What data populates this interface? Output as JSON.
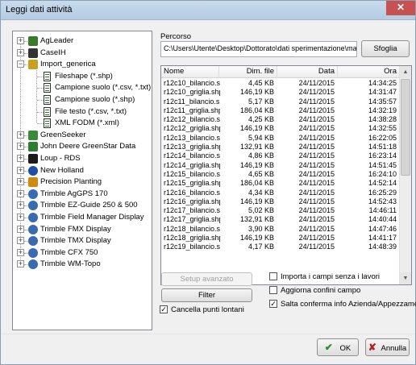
{
  "window": {
    "title": "Leggi dati attività",
    "close_glyph": "✕"
  },
  "tree": {
    "items": [
      {
        "label": "AgLeader",
        "icon": "agleader-logo-icon",
        "expander": "+"
      },
      {
        "label": "CaseIH",
        "icon": "caseih-logo-icon",
        "expander": "+"
      },
      {
        "label": "Import_generica",
        "icon": "folder-icon",
        "expander": "−"
      },
      {
        "label": "Fileshape (*.shp)",
        "icon": "document-icon"
      },
      {
        "label": "Campione suolo (*.csv, *.txt)",
        "icon": "document-icon"
      },
      {
        "label": "Campione suolo (*.shp)",
        "icon": "document-icon"
      },
      {
        "label": "File testo (*.csv, *.txt)",
        "icon": "document-icon"
      },
      {
        "label": "XML FODM (*.xml)",
        "icon": "document-icon"
      },
      {
        "label": "GreenSeeker",
        "icon": "greenseeker-logo-icon",
        "expander": "+"
      },
      {
        "label": "John Deere GreenStar Data",
        "icon": "john-deere-logo-icon",
        "expander": "+"
      },
      {
        "label": "Loup - RDS",
        "icon": "loup-logo-icon",
        "expander": "+"
      },
      {
        "label": "New Holland",
        "icon": "new-holland-logo-icon",
        "expander": "+"
      },
      {
        "label": "Precision Planting",
        "icon": "precision-planting-logo-icon",
        "expander": "+"
      },
      {
        "label": "Trimble AgGPS 170",
        "icon": "trimble-logo-icon",
        "expander": "+"
      },
      {
        "label": "Trimble EZ-Guide 250 & 500",
        "icon": "trimble-logo-icon",
        "expander": "+"
      },
      {
        "label": "Trimble Field Manager Display",
        "icon": "trimble-logo-icon",
        "expander": "+"
      },
      {
        "label": "Trimble FMX Display",
        "icon": "trimble-logo-icon",
        "expander": "+"
      },
      {
        "label": "Trimble TMX Display",
        "icon": "trimble-logo-icon",
        "expander": "+"
      },
      {
        "label": "Trimble CFX 750",
        "icon": "trimble-logo-icon",
        "expander": "+"
      },
      {
        "label": "Trimble WM-Topo",
        "icon": "trimble-logo-icon",
        "expander": "+"
      }
    ]
  },
  "path": {
    "label": "Percorso",
    "value": "C:\\Users\\Utente\\Desktop\\Dottorato\\dati sperimentazione\\mappe agr",
    "browse_label": "Sfoglia"
  },
  "file_list": {
    "columns": [
      "Nome",
      "Dim. file",
      "Data",
      "Ora"
    ],
    "rows": [
      [
        "r12c10_bilancio.s...",
        "4,45 KB",
        "24/11/2015",
        "14:34:25"
      ],
      [
        "r12c10_griglia.shp",
        "146,19 KB",
        "24/11/2015",
        "14:31:47"
      ],
      [
        "r12c11_bilancio.s...",
        "5,17 KB",
        "24/11/2015",
        "14:35:57"
      ],
      [
        "r12c11_griglia.shp",
        "186,04 KB",
        "24/11/2015",
        "14:32:19"
      ],
      [
        "r12c12_bilancio.s...",
        "4,25 KB",
        "24/11/2015",
        "14:38:28"
      ],
      [
        "r12c12_griglia.shp",
        "146,19 KB",
        "24/11/2015",
        "14:32:55"
      ],
      [
        "r12c13_bilancio.s...",
        "5,94 KB",
        "24/11/2015",
        "16:22:05"
      ],
      [
        "r12c13_griglia.shp",
        "132,91 KB",
        "24/11/2015",
        "14:51:18"
      ],
      [
        "r12c14_bilancio.s...",
        "4,86 KB",
        "24/11/2015",
        "16:23:14"
      ],
      [
        "r12c14_griglia.shp",
        "146,19 KB",
        "24/11/2015",
        "14:51:45"
      ],
      [
        "r12c15_bilancio.s...",
        "4,65 KB",
        "24/11/2015",
        "16:24:10"
      ],
      [
        "r12c15_griglia.shp",
        "186,04 KB",
        "24/11/2015",
        "14:52:14"
      ],
      [
        "r12c16_bilancio.s...",
        "4,34 KB",
        "24/11/2015",
        "16:25:29"
      ],
      [
        "r12c16_griglia.shp",
        "146,19 KB",
        "24/11/2015",
        "14:52:43"
      ],
      [
        "r12c17_bilancio.s...",
        "5,02 KB",
        "24/11/2015",
        "14:46:11"
      ],
      [
        "r12c17_griglia.shp",
        "132,91 KB",
        "24/11/2015",
        "14:40:44"
      ],
      [
        "r12c18_bilancio.s...",
        "3,90 KB",
        "24/11/2015",
        "14:47:46"
      ],
      [
        "r12c18_griglia.shp",
        "146,19 KB",
        "24/11/2015",
        "14:41:17"
      ],
      [
        "r12c19_bilancio.s...",
        "4,17 KB",
        "24/11/2015",
        "14:48:39"
      ]
    ]
  },
  "buttons": {
    "setup": "Setup avanzato",
    "filter": "Filter",
    "ok": "OK",
    "cancel": "Annulla"
  },
  "options": {
    "cancella_punti": {
      "label": "Cancella punti lontani",
      "checked": true
    },
    "importa_campi": {
      "label": "Importa i campi senza i lavori",
      "checked": false
    },
    "aggiorna_confini": {
      "label": "Aggiorna confini campo",
      "checked": false
    },
    "salta_conferma": {
      "label": "Salta conferma info Azienda/Appezzamento",
      "checked": true
    }
  },
  "colors": {
    "ok_check": "#2b8a2b",
    "cancel_x": "#b22222",
    "title_bar": "#c9dbec"
  }
}
